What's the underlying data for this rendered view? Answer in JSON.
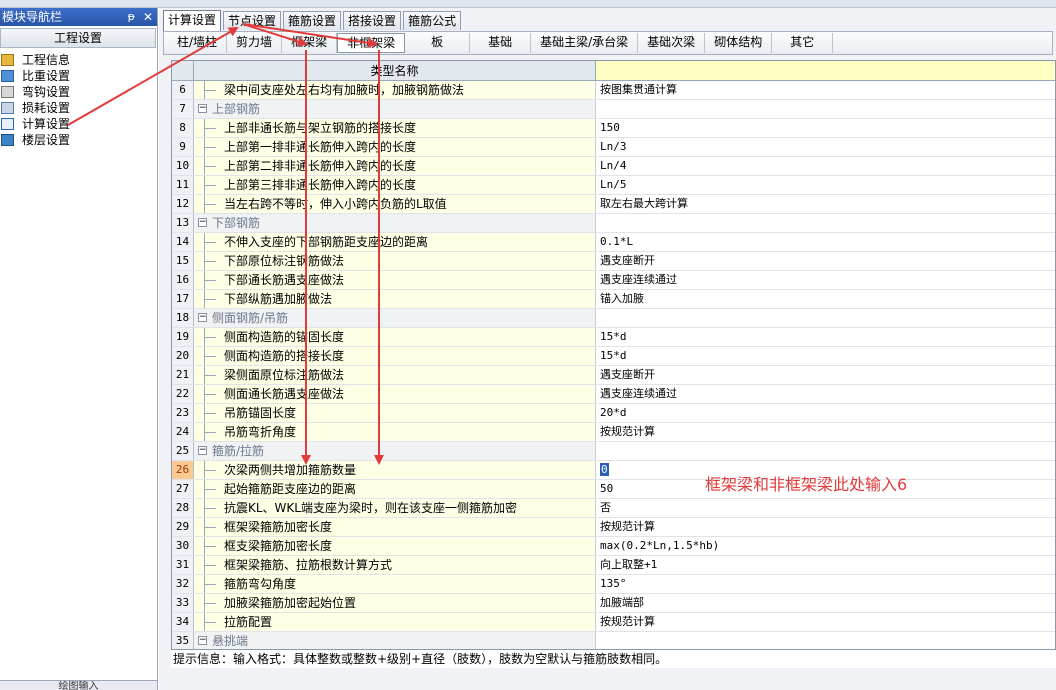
{
  "navigator": {
    "title": "模块导航栏",
    "pin": "ᵽ",
    "close": "✕",
    "section": "工程设置",
    "items": [
      {
        "label": "工程信息",
        "icon": "project-info-icon"
      },
      {
        "label": "比重设置",
        "icon": "density-icon"
      },
      {
        "label": "弯钩设置",
        "icon": "hook-icon"
      },
      {
        "label": "损耗设置",
        "icon": "loss-icon"
      },
      {
        "label": "计算设置",
        "icon": "calc-settings-icon"
      },
      {
        "label": "楼层设置",
        "icon": "floor-icon"
      }
    ],
    "bottom": "绘图输入"
  },
  "tabs_top": [
    {
      "label": "计算设置",
      "active": true
    },
    {
      "label": "节点设置",
      "active": false
    },
    {
      "label": "箍筋设置",
      "active": false
    },
    {
      "label": "搭接设置",
      "active": false
    },
    {
      "label": "箍筋公式",
      "active": false
    }
  ],
  "tabs_sub": [
    {
      "label": "柱/墙柱",
      "active": false
    },
    {
      "label": "剪力墙",
      "active": false
    },
    {
      "label": "框架梁",
      "active": false
    },
    {
      "label": "非框架梁",
      "active": true
    },
    {
      "label": "板",
      "active": false
    },
    {
      "label": "基础",
      "active": false
    },
    {
      "label": "基础主梁/承台梁",
      "active": false
    },
    {
      "label": "基础次梁",
      "active": false
    },
    {
      "label": "砌体结构",
      "active": false
    },
    {
      "label": "其它",
      "active": false
    }
  ],
  "grid": {
    "header_name": "类型名称",
    "rows": [
      {
        "num": "6",
        "name": "梁中间支座处左右均有加腋时，加腋钢筋做法",
        "value": "按图集贯通计算",
        "group": false
      },
      {
        "num": "7",
        "name": "上部钢筋",
        "value": "",
        "group": true
      },
      {
        "num": "8",
        "name": "上部非通长筋与架立钢筋的搭接长度",
        "value": "150",
        "group": false
      },
      {
        "num": "9",
        "name": "上部第一排非通长筋伸入跨内的长度",
        "value": "Ln/3",
        "group": false
      },
      {
        "num": "10",
        "name": "上部第二排非通长筋伸入跨内的长度",
        "value": "Ln/4",
        "group": false
      },
      {
        "num": "11",
        "name": "上部第三排非通长筋伸入跨内的长度",
        "value": "Ln/5",
        "group": false
      },
      {
        "num": "12",
        "name": "当左右跨不等时，伸入小跨内负筋的L取值",
        "value": "取左右最大跨计算",
        "group": false
      },
      {
        "num": "13",
        "name": "下部钢筋",
        "value": "",
        "group": true
      },
      {
        "num": "14",
        "name": "不伸入支座的下部钢筋距支座边的距离",
        "value": "0.1*L",
        "group": false
      },
      {
        "num": "15",
        "name": "下部原位标注钢筋做法",
        "value": "遇支座断开",
        "group": false
      },
      {
        "num": "16",
        "name": "下部通长筋遇支座做法",
        "value": "遇支座连续通过",
        "group": false
      },
      {
        "num": "17",
        "name": "下部纵筋遇加腋做法",
        "value": "锚入加腋",
        "group": false
      },
      {
        "num": "18",
        "name": "侧面钢筋/吊筋",
        "value": "",
        "group": true
      },
      {
        "num": "19",
        "name": "侧面构造筋的锚固长度",
        "value": "15*d",
        "group": false
      },
      {
        "num": "20",
        "name": "侧面构造筋的搭接长度",
        "value": "15*d",
        "group": false
      },
      {
        "num": "21",
        "name": "梁侧面原位标注筋做法",
        "value": "遇支座断开",
        "group": false
      },
      {
        "num": "22",
        "name": "侧面通长筋遇支座做法",
        "value": "遇支座连续通过",
        "group": false
      },
      {
        "num": "23",
        "name": "吊筋锚固长度",
        "value": "20*d",
        "group": false
      },
      {
        "num": "24",
        "name": "吊筋弯折角度",
        "value": "按规范计算",
        "group": false
      },
      {
        "num": "25",
        "name": "箍筋/拉筋",
        "value": "",
        "group": true
      },
      {
        "num": "26",
        "name": "次梁两侧共增加箍筋数量",
        "value": "0",
        "group": false,
        "current": true
      },
      {
        "num": "27",
        "name": "起始箍筋距支座边的距离",
        "value": "50",
        "group": false
      },
      {
        "num": "28",
        "name": "抗震KL、WKL端支座为梁时，则在该支座一侧箍筋加密",
        "value": "否",
        "group": false
      },
      {
        "num": "29",
        "name": "框架梁箍筋加密长度",
        "value": "按规范计算",
        "group": false
      },
      {
        "num": "30",
        "name": "框支梁箍筋加密长度",
        "value": "max(0.2*Ln,1.5*hb)",
        "group": false
      },
      {
        "num": "31",
        "name": "框架梁箍筋、拉筋根数计算方式",
        "value": "向上取整+1",
        "group": false
      },
      {
        "num": "32",
        "name": "箍筋弯勾角度",
        "value": "135°",
        "group": false
      },
      {
        "num": "33",
        "name": "加腋梁箍筋加密起始位置",
        "value": "加腋端部",
        "group": false
      },
      {
        "num": "34",
        "name": "拉筋配置",
        "value": "按规范计算",
        "group": false
      },
      {
        "num": "35",
        "name": "悬挑端",
        "value": "",
        "group": true
      }
    ]
  },
  "hint": "提示信息：输入格式：具体整数或整数+级别+直径（肢数），肢数为空默认与箍筋肢数相同。",
  "annotation": "框架梁和非框架梁此处输入6",
  "colors": {
    "annotation": "#e23b3b",
    "value_header": "#ffffc4",
    "name_cell": "#ffffe6",
    "current_row": "#f8c990"
  }
}
